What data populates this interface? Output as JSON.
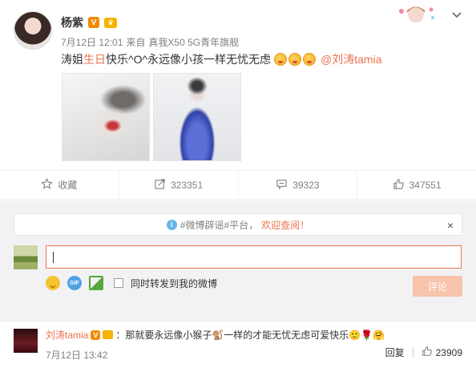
{
  "post": {
    "author": "杨紫",
    "meta_date": "7月12日 12:01",
    "meta_source_prefix": "来自",
    "meta_source": "真我X50 5G青年旗舰",
    "text_part1": "涛姐",
    "text_highlight": "生日",
    "text_part2": "快乐^O^永远像小孩一样无忧无虑",
    "mention": "@刘涛tamia"
  },
  "actions": {
    "favorite": "收藏",
    "repost_count": "323351",
    "comment_count": "39323",
    "like_count": "347551"
  },
  "comment_panel": {
    "notice_text": "#微博辟谣#平台，",
    "notice_link": "欢迎查阅！",
    "notice_close": "×",
    "repost_checkbox_label": "同时转发到我的微博",
    "submit_label": "评论",
    "gif_label": "GIF"
  },
  "comment": {
    "user": "刘涛tamia",
    "text": "：那就要永远像小猴子🐒一样的才能无忧无虑可爱快乐🙂🌹🤗",
    "time": "7月12日 13:42",
    "reply_label": "回复",
    "like_count": "23909"
  },
  "colors": {
    "accent": "#eb7350",
    "verified": "#f28a00",
    "panel_bg": "#f2f2f5"
  },
  "icons": [
    "star-icon",
    "repost-icon",
    "comment-icon",
    "like-icon",
    "info-icon",
    "emoji-icon",
    "gif-icon",
    "picture-icon",
    "chevron-down-icon"
  ]
}
